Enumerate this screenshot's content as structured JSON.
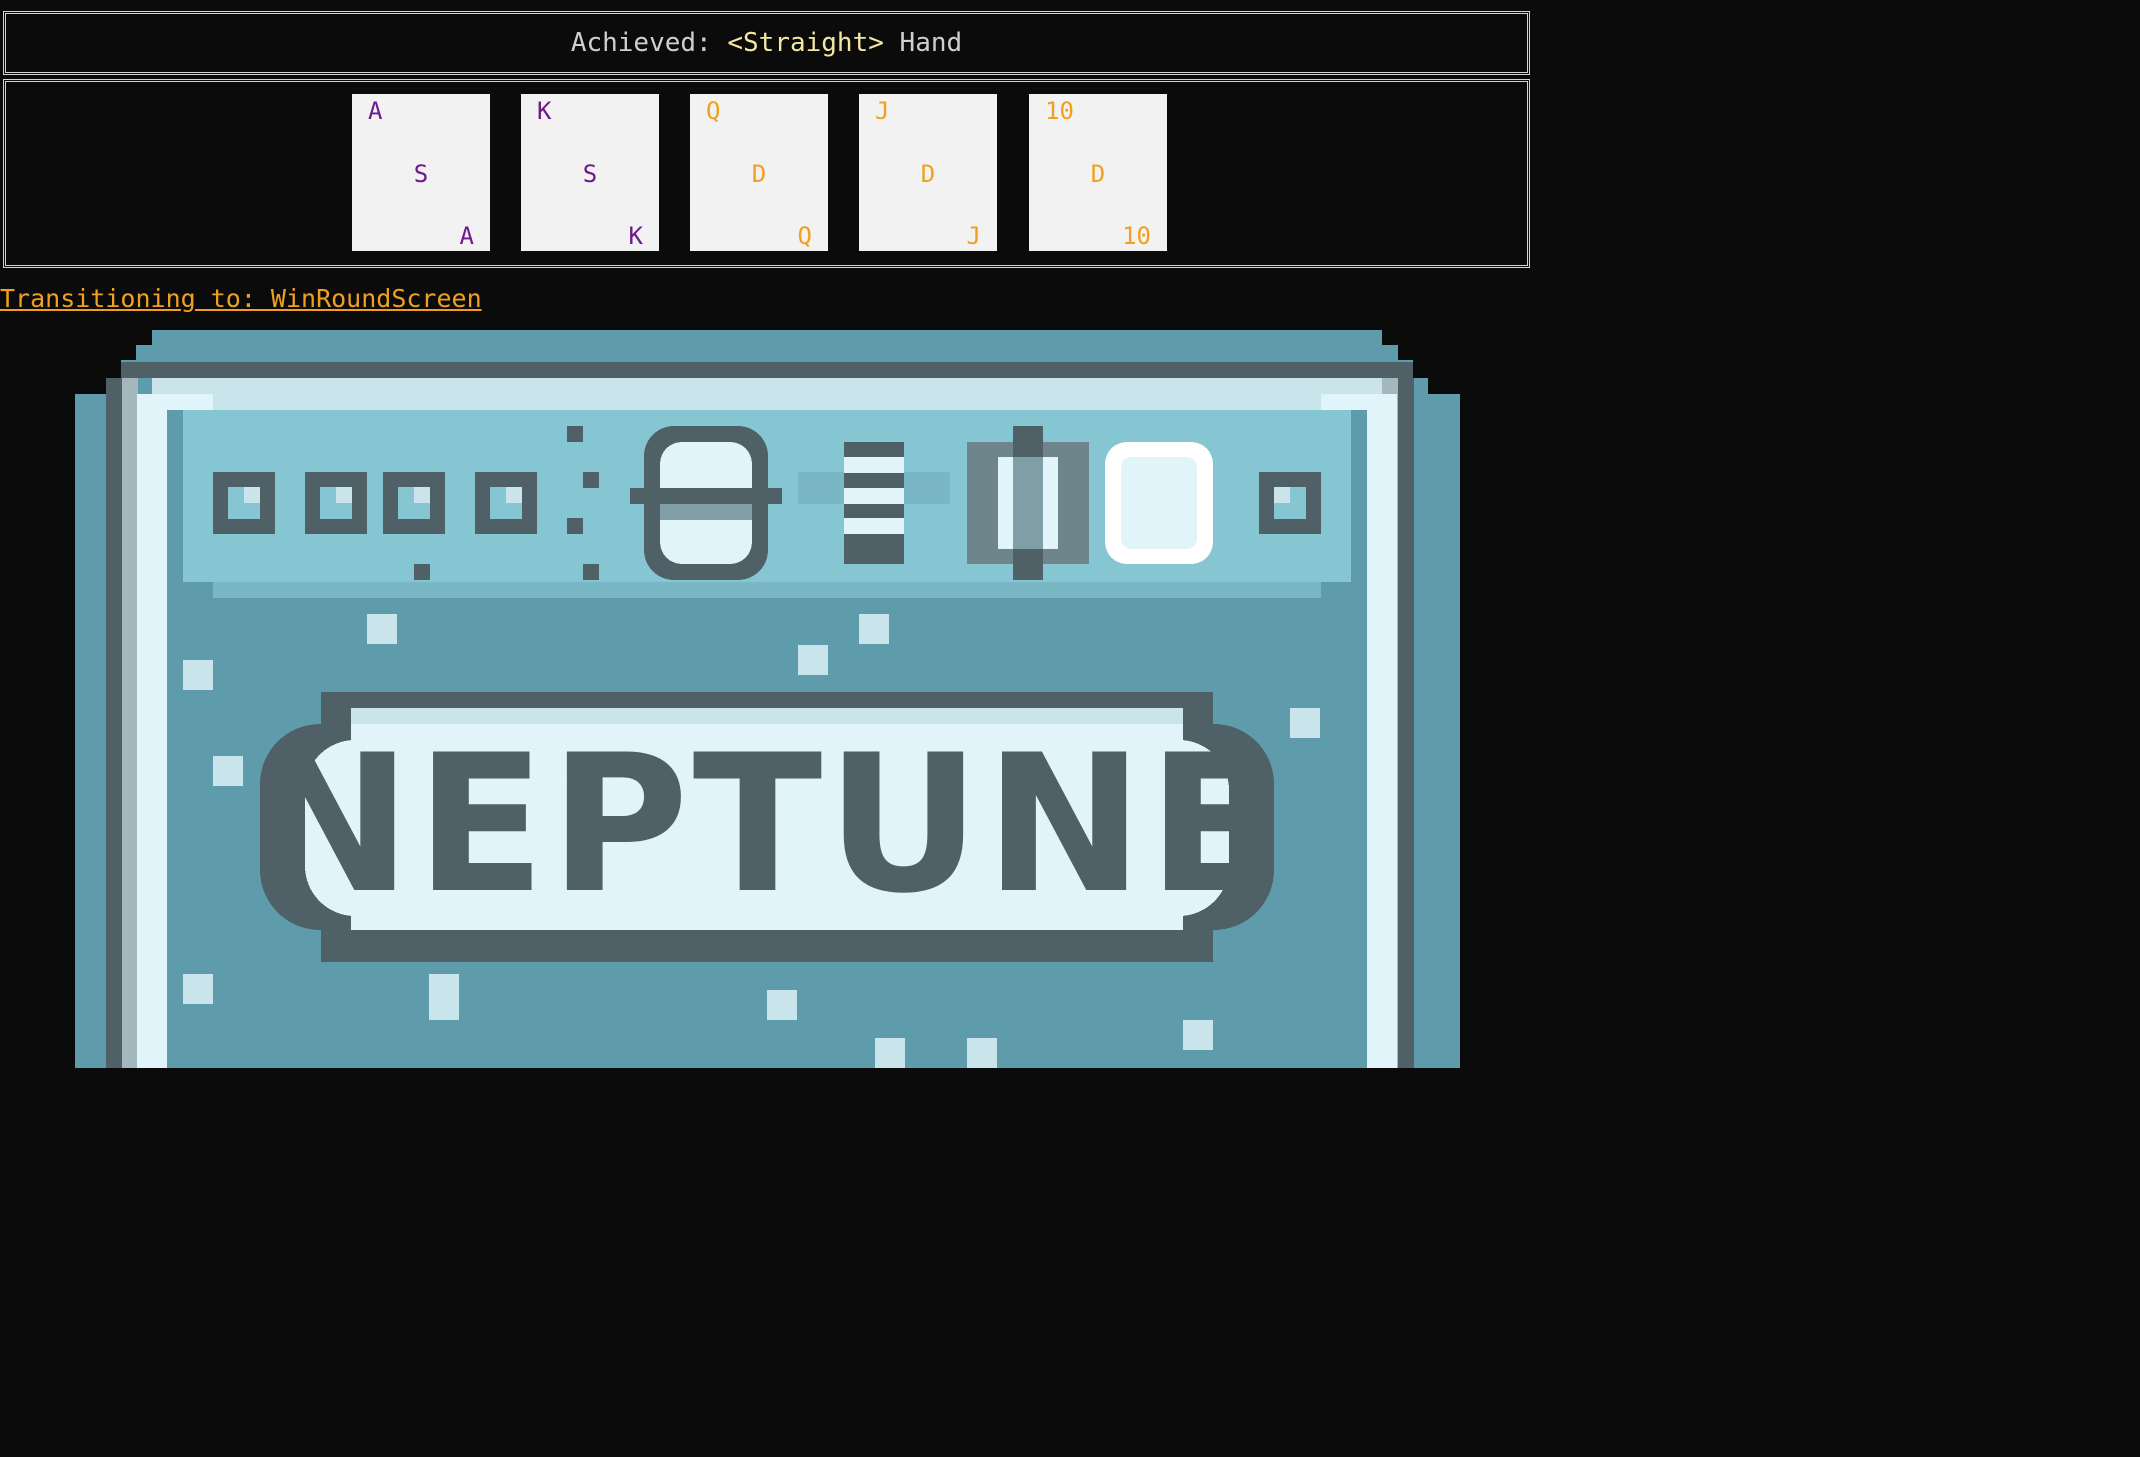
{
  "header": {
    "prefix": "Achieved: ",
    "hand": "<Straight>",
    "suffix": " Hand"
  },
  "cards": [
    {
      "rank": "A",
      "suit": "S",
      "color": "#6e1a8c"
    },
    {
      "rank": "K",
      "suit": "S",
      "color": "#6e1a8c"
    },
    {
      "rank": "Q",
      "suit": "D",
      "color": "#f0a01e"
    },
    {
      "rank": "J",
      "suit": "D",
      "color": "#f0a01e"
    },
    {
      "rank": "10",
      "suit": "D",
      "color": "#f0a01e"
    }
  ],
  "transition": "Transitioning to: WinRoundScreen",
  "planet_card": {
    "name": "NEPTUNE",
    "frame_color": "#5e9cab",
    "inner_color": "#85c6d2",
    "banner_color": "#e0f4fa",
    "text_color": "#4f6166"
  }
}
